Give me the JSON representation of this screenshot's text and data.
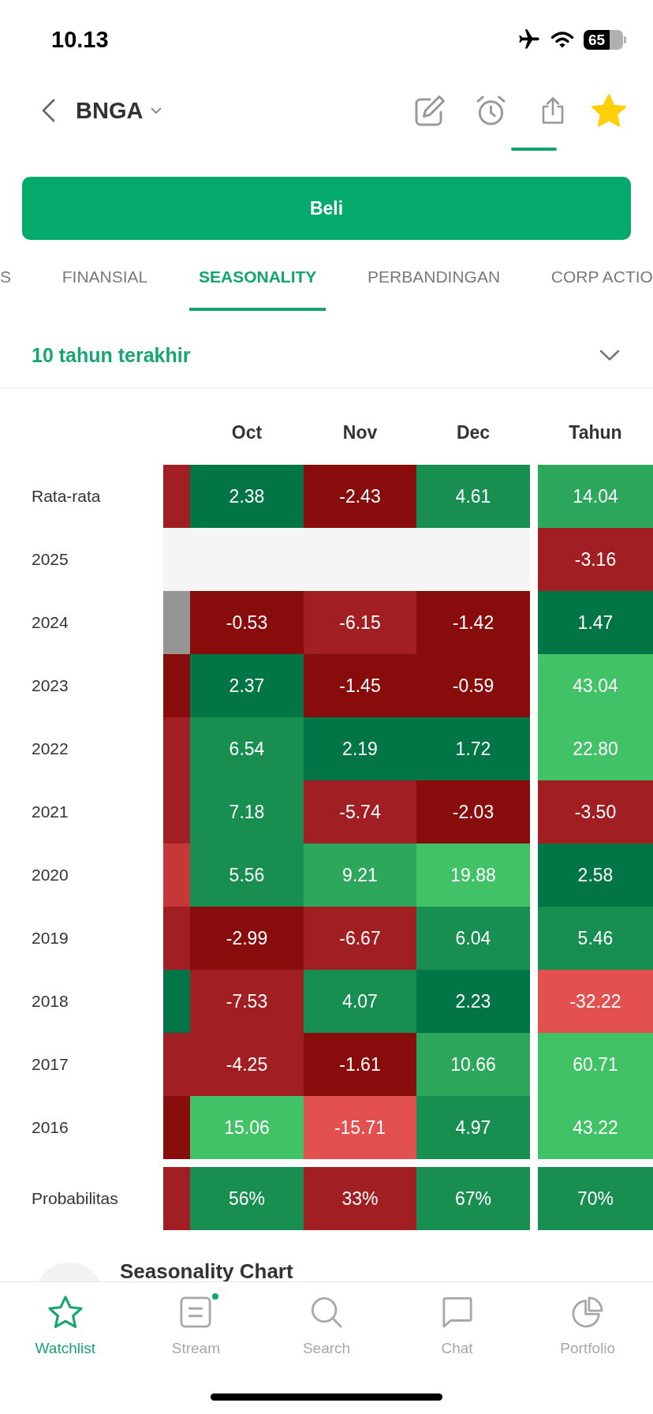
{
  "status_bar": {
    "time": "10.13",
    "battery": "65"
  },
  "header": {
    "title": "BNGA",
    "favorite": true
  },
  "buy_button": {
    "label": "Beli"
  },
  "tabs": [
    {
      "label": "S",
      "selected": false
    },
    {
      "label": "FINANSIAL",
      "selected": false
    },
    {
      "label": "SEASONALITY",
      "selected": true
    },
    {
      "label": "PERBANDINGAN",
      "selected": false
    },
    {
      "label": "CORP ACTIO",
      "selected": false
    }
  ],
  "period_dropdown": {
    "value": "10 tahun terakhir"
  },
  "table": {
    "columns": [
      "Oct",
      "Nov",
      "Dec",
      "Tahun"
    ],
    "rows": [
      {
        "label": "Rata-rata",
        "column_0": {
          "color": "#a11f22"
        },
        "months": [
          {
            "value": "2.38",
            "color": "#017545"
          },
          {
            "value": "-2.43",
            "color": "#880c0c"
          },
          {
            "value": "4.61",
            "color": "#188f50"
          }
        ],
        "year": {
          "value": "14.04",
          "color": "#2ca75b"
        }
      },
      {
        "label": "2025",
        "blank_band": {
          "color": "#f5f5f6"
        },
        "year": {
          "value": "-3.16",
          "color": "#a11f22"
        }
      },
      {
        "label": "2024",
        "column_0": {
          "color": "#959595"
        },
        "months": [
          {
            "value": "-0.53",
            "color": "#880c0c"
          },
          {
            "value": "-6.15",
            "color": "#a11f22"
          },
          {
            "value": "-1.42",
            "color": "#880c0c"
          }
        ],
        "year": {
          "value": "1.47",
          "color": "#017545"
        }
      },
      {
        "label": "2023",
        "column_0": {
          "color": "#880c0c"
        },
        "months": [
          {
            "value": "2.37",
            "color": "#017545"
          },
          {
            "value": "-1.45",
            "color": "#880c0c"
          },
          {
            "value": "-0.59",
            "color": "#880c0c"
          }
        ],
        "year": {
          "value": "43.04",
          "color": "#42c266"
        }
      },
      {
        "label": "2022",
        "column_0": {
          "color": "#a11f22"
        },
        "months": [
          {
            "value": "6.54",
            "color": "#188f50"
          },
          {
            "value": "2.19",
            "color": "#017545"
          },
          {
            "value": "1.72",
            "color": "#017545"
          }
        ],
        "year": {
          "value": "22.80",
          "color": "#42c266"
        }
      },
      {
        "label": "2021",
        "column_0": {
          "color": "#a11f22"
        },
        "months": [
          {
            "value": "7.18",
            "color": "#188f50"
          },
          {
            "value": "-5.74",
            "color": "#a11f22"
          },
          {
            "value": "-2.03",
            "color": "#880c0c"
          }
        ],
        "year": {
          "value": "-3.50",
          "color": "#a11f22"
        }
      },
      {
        "label": "2020",
        "column_0": {
          "color": "#c53839"
        },
        "months": [
          {
            "value": "5.56",
            "color": "#188f50"
          },
          {
            "value": "9.21",
            "color": "#2ca75b"
          },
          {
            "value": "19.88",
            "color": "#42c266"
          }
        ],
        "year": {
          "value": "2.58",
          "color": "#017545"
        }
      },
      {
        "label": "2019",
        "column_0": {
          "color": "#a11f22"
        },
        "months": [
          {
            "value": "-2.99",
            "color": "#880c0c"
          },
          {
            "value": "-6.67",
            "color": "#a11f22"
          },
          {
            "value": "6.04",
            "color": "#188f50"
          }
        ],
        "year": {
          "value": "5.46",
          "color": "#188f50"
        }
      },
      {
        "label": "2018",
        "column_0": {
          "color": "#017545"
        },
        "months": [
          {
            "value": "-7.53",
            "color": "#a11f22"
          },
          {
            "value": "4.07",
            "color": "#188f50"
          },
          {
            "value": "2.23",
            "color": "#017545"
          }
        ],
        "year": {
          "value": "-32.22",
          "color": "#e25050"
        }
      },
      {
        "label": "2017",
        "column_0": {
          "color": "#a11f22"
        },
        "months": [
          {
            "value": "-4.25",
            "color": "#a11f22"
          },
          {
            "value": "-1.61",
            "color": "#880c0c"
          },
          {
            "value": "10.66",
            "color": "#2ca75b"
          }
        ],
        "year": {
          "value": "60.71",
          "color": "#42c266"
        }
      },
      {
        "label": "2016",
        "column_0": {
          "color": "#880c0c"
        },
        "months": [
          {
            "value": "15.06",
            "color": "#42c266"
          },
          {
            "value": "-15.71",
            "color": "#e25050"
          },
          {
            "value": "4.97",
            "color": "#188f50"
          }
        ],
        "year": {
          "value": "43.22",
          "color": "#42c266"
        }
      }
    ],
    "probability_row": {
      "label": "Probabilitas",
      "column_0": {
        "color": "#a11f22"
      },
      "months": [
        {
          "value": "56%",
          "color": "#188f50"
        },
        {
          "value": "33%",
          "color": "#a11f22"
        },
        {
          "value": "67%",
          "color": "#188f50"
        }
      ],
      "year": {
        "value": "70%",
        "color": "#188f50"
      }
    }
  },
  "section": {
    "title": "Seasonality Chart"
  },
  "bottom_nav": [
    {
      "label": "Watchlist",
      "selected": true,
      "dot": false
    },
    {
      "label": "Stream",
      "selected": false,
      "dot": true
    },
    {
      "label": "Search",
      "selected": false,
      "dot": false
    },
    {
      "label": "Chat",
      "selected": false,
      "dot": false
    },
    {
      "label": "Portfolio",
      "selected": false,
      "dot": false
    }
  ]
}
